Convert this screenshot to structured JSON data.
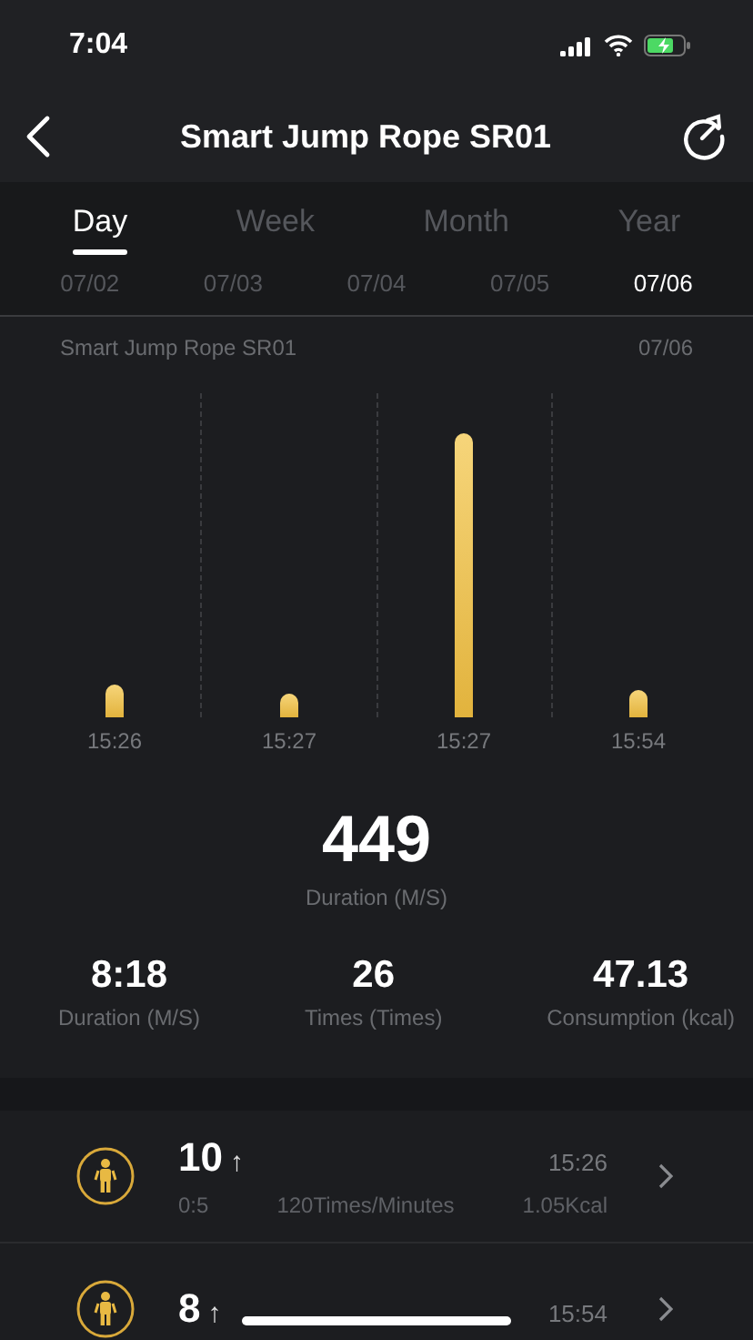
{
  "status_bar": {
    "time": "7:04"
  },
  "nav": {
    "title": "Smart Jump Rope SR01"
  },
  "tabs": [
    {
      "label": "Day",
      "selected": true
    },
    {
      "label": "Week",
      "selected": false
    },
    {
      "label": "Month",
      "selected": false
    },
    {
      "label": "Year",
      "selected": false
    }
  ],
  "dates": [
    {
      "label": "07/02",
      "selected": false
    },
    {
      "label": "07/03",
      "selected": false
    },
    {
      "label": "07/04",
      "selected": false
    },
    {
      "label": "07/05",
      "selected": false
    },
    {
      "label": "07/06",
      "selected": true
    }
  ],
  "chart": {
    "device": "Smart Jump Rope SR01",
    "date": "07/06",
    "times": [
      "15:26",
      "15:27",
      "15:27",
      "15:54"
    ]
  },
  "summary": {
    "value": "449",
    "label": "Duration (M/S)"
  },
  "stats": [
    {
      "value": "8:18",
      "label": "Duration (M/S)"
    },
    {
      "value": "26",
      "label": "Times (Times)"
    },
    {
      "value": "47.13",
      "label": "Consumption (kcal)"
    }
  ],
  "sessions": [
    {
      "count": "10",
      "arrow": "↑",
      "time": "15:26",
      "duration": "0:5",
      "rate": "120Times/Minutes",
      "energy": "1.05Kcal"
    },
    {
      "count": "8",
      "arrow": "↑",
      "time": "15:54"
    }
  ]
}
